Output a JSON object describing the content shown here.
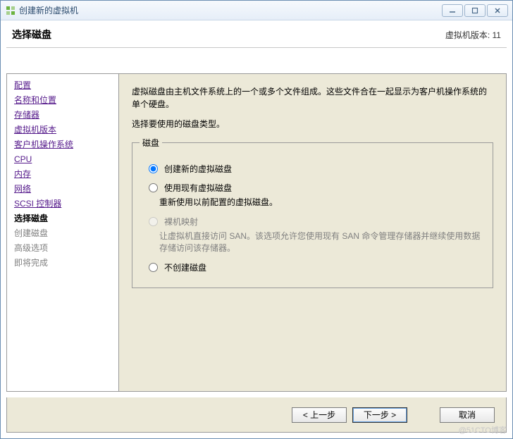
{
  "window": {
    "title": "创建新的虚拟机"
  },
  "header": {
    "title": "选择磁盘",
    "version": "虚拟机版本: 11"
  },
  "sidebar": {
    "items": [
      {
        "label": "配置",
        "state": "done"
      },
      {
        "label": "名称和位置",
        "state": "done"
      },
      {
        "label": "存储器",
        "state": "done"
      },
      {
        "label": "虚拟机版本",
        "state": "done"
      },
      {
        "label": "客户机操作系统",
        "state": "done"
      },
      {
        "label": "CPU",
        "state": "done"
      },
      {
        "label": "内存",
        "state": "done"
      },
      {
        "label": "网络",
        "state": "done"
      },
      {
        "label": "SCSI 控制器",
        "state": "done"
      },
      {
        "label": "选择磁盘",
        "state": "current"
      },
      {
        "label": "创建磁盘",
        "state": "pending"
      },
      {
        "label": "高级选项",
        "state": "pending"
      },
      {
        "label": "即将完成",
        "state": "pending"
      }
    ]
  },
  "main": {
    "description": "虚拟磁盘由主机文件系统上的一个或多个文件组成。这些文件合在一起显示为客户机操作系统的单个硬盘。",
    "instruction": "选择要使用的磁盘类型。",
    "group_legend": "磁盘",
    "options": [
      {
        "label": "创建新的虚拟磁盘",
        "desc": "",
        "enabled": true,
        "selected": true
      },
      {
        "label": "使用现有虚拟磁盘",
        "desc": "重新使用以前配置的虚拟磁盘。",
        "enabled": true,
        "selected": false
      },
      {
        "label": "裸机映射",
        "desc": "让虚拟机直接访问 SAN。该选项允许您使用现有 SAN 命令管理存储器并继续使用数据存储访问该存储器。",
        "enabled": false,
        "selected": false
      },
      {
        "label": "不创建磁盘",
        "desc": "",
        "enabled": true,
        "selected": false
      }
    ]
  },
  "footer": {
    "back": "< 上一步",
    "next": "下一步 >",
    "cancel": "取消"
  },
  "watermark": "@51CTO博客"
}
